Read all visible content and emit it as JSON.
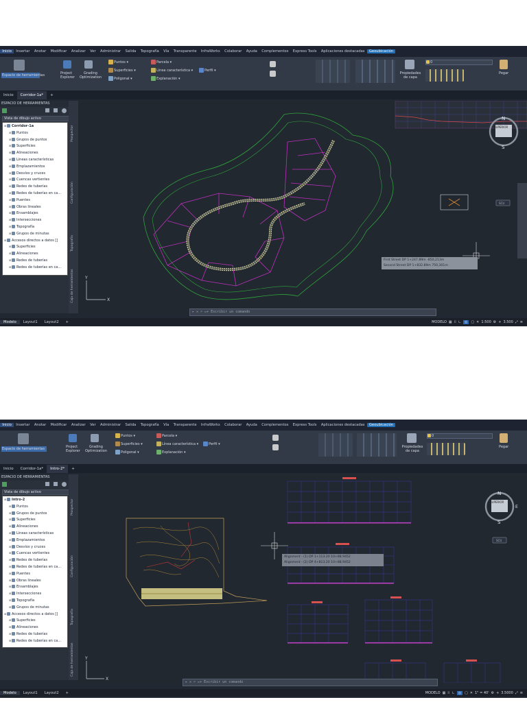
{
  "menu": [
    "Inicio",
    "Insertar",
    "Anotar",
    "Modificar",
    "Analizar",
    "Ver",
    "Administrar",
    "Salida",
    "Topografía",
    "Vía",
    "Transparente",
    "InfraWorks",
    "Colaborar",
    "Ayuda",
    "Complementos",
    "Express Tools",
    "Aplicaciones destacadas",
    "Geoubicación"
  ],
  "ribbon": {
    "espacio": "Espacio de herramientas",
    "project_explorer": "Project Explorer",
    "grading": "Grading Optimization",
    "puntos": "Puntos",
    "superficies": "Superficies",
    "poligonal": "Poligonal",
    "parcela": "Parcela",
    "linea": "Línea característica",
    "explanacion": "Explanación",
    "perfil": "Perfil",
    "propiedades_capa": "Propiedades de capa",
    "pegar": "Pegar",
    "layer_value": "0",
    "panels": [
      "Paletas",
      "Explorar",
      "Optimizar",
      "Crear datos de terreno",
      "Crear diseño",
      "Visualizaciones del perfil y vistas en sección",
      "Dibujo",
      "Modificar",
      "Capas",
      "Portapapeles"
    ]
  },
  "shot1": {
    "tabs": [
      "Inicio",
      "Corridor-1a*"
    ],
    "palette_title": "ESPACIO DE HERRAMIENTAS",
    "view_select": "Vista de dibujo activo",
    "tree": [
      {
        "label": "Corridor-1a",
        "level": 0,
        "bold": true
      },
      {
        "label": "Puntos",
        "level": 1
      },
      {
        "label": "Grupos de puntos",
        "level": 1
      },
      {
        "label": "Superficies",
        "level": 1
      },
      {
        "label": "Alineaciones",
        "level": 1
      },
      {
        "label": "Líneas características",
        "level": 1
      },
      {
        "label": "Emplazamientos",
        "level": 1
      },
      {
        "label": "Desvíos y cruces",
        "level": 1
      },
      {
        "label": "Cuencas vertientes",
        "level": 1
      },
      {
        "label": "Redes de tuberías",
        "level": 1
      },
      {
        "label": "Redes de tuberías en ca...",
        "level": 1
      },
      {
        "label": "Puentes",
        "level": 1
      },
      {
        "label": "Obras lineales",
        "level": 1
      },
      {
        "label": "Ensamblajes",
        "level": 1
      },
      {
        "label": "Intersecciones",
        "level": 1
      },
      {
        "label": "Topografía",
        "level": 1
      },
      {
        "label": "Grupos de minutas",
        "level": 1
      },
      {
        "label": "Accesos directos a datos []",
        "level": 0
      },
      {
        "label": "Superficies",
        "level": 1
      },
      {
        "label": "Alineaciones",
        "level": 1
      },
      {
        "label": "Redes de tuberías",
        "level": 1
      },
      {
        "label": "Redes de tuberías en ca...",
        "level": 1
      }
    ],
    "side_tabs": [
      "Prospector",
      "Configuración",
      "Topografía",
      "Caja de herramientas"
    ],
    "tooltip": [
      "First Street   DP   1+247.89m   -850,213m",
      "Second Street  DP   1+832.89m   750,301m"
    ],
    "cmd_placeholder": "Escribir un comando",
    "layouts": [
      "Modelo",
      "Layout1",
      "Layout2",
      "+"
    ],
    "status": {
      "mode": "MODELO",
      "scale": "1:500",
      "value": "3.500"
    },
    "compass": {
      "n": "N",
      "s": "S",
      "e": "E",
      "face": "SUPERIOR",
      "wcs": "SCU"
    }
  },
  "shot2": {
    "tabs": [
      "Inicio",
      "Corridor-1a*",
      "Intro-2*"
    ],
    "palette_title": "ESPACIO DE HERRAMIENTAS",
    "view_select": "Vista de dibujo activo",
    "tree": [
      {
        "label": "Intro-2",
        "level": 0,
        "bold": true
      },
      {
        "label": "Puntos",
        "level": 1
      },
      {
        "label": "Grupos de puntos",
        "level": 1
      },
      {
        "label": "Superficies",
        "level": 1
      },
      {
        "label": "Alineaciones",
        "level": 1
      },
      {
        "label": "Líneas características",
        "level": 1
      },
      {
        "label": "Emplazamientos",
        "level": 1
      },
      {
        "label": "Desvíos y cruces",
        "level": 1
      },
      {
        "label": "Cuencas vertientes",
        "level": 1
      },
      {
        "label": "Redes de tuberías",
        "level": 1
      },
      {
        "label": "Redes de tuberías en ca...",
        "level": 1
      },
      {
        "label": "Puentes",
        "level": 1
      },
      {
        "label": "Obras lineales",
        "level": 1
      },
      {
        "label": "Ensamblajes",
        "level": 1
      },
      {
        "label": "Intersecciones",
        "level": 1
      },
      {
        "label": "Topografía",
        "level": 1
      },
      {
        "label": "Grupos de minutas",
        "level": 1
      },
      {
        "label": "Accesos directos a datos []",
        "level": 0
      },
      {
        "label": "Superficies",
        "level": 1
      },
      {
        "label": "Alineaciones",
        "level": 1
      },
      {
        "label": "Redes de tuberías",
        "level": 1
      },
      {
        "label": "Redes de tuberías en ca...",
        "level": 1
      }
    ],
    "side_tabs": [
      "Prospector",
      "Configuración",
      "Topografía",
      "Caja de herramientas"
    ],
    "tooltip": [
      "Alignment - (1)   DP   1+113.20   10+88.9452",
      "Alignment - (2)   DP   4+813.20   10+88.9452"
    ],
    "cmd_placeholder": "Escribir un comando",
    "layouts": [
      "Modelo",
      "Layout1",
      "Layout2",
      "+"
    ],
    "status": {
      "mode": "MODELO",
      "scale": "1\" = 40'",
      "value": "3.5000"
    },
    "compass": {
      "n": "N",
      "s": "S",
      "e": "E",
      "face": "SUPERIOR",
      "wcs": "SCU"
    }
  },
  "colors": {
    "accent": "#1f6fb8",
    "magenta": "#c030c0",
    "green": "#2fa83a",
    "road": "#d9d2a0",
    "grid": "#3a3aa0"
  }
}
